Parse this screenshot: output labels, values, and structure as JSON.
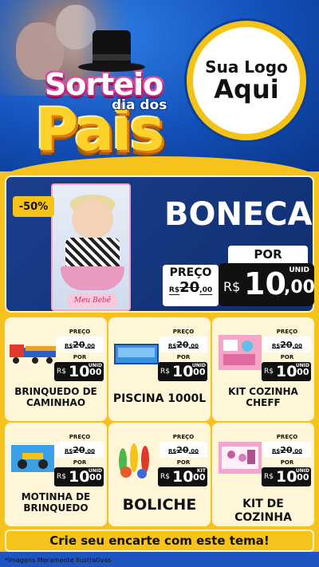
{
  "header": {
    "title_top": "Sorteio",
    "title_mid": "dia dos",
    "title_big": "Pais",
    "logo_line1": "Sua Logo",
    "logo_line2": "Aqui"
  },
  "hero": {
    "discount": "-50%",
    "box_label": "Meu Bebê",
    "name": "BONECA",
    "por_label": "POR",
    "preco_label": "PREÇO",
    "old_currency": "R$",
    "old_int": "20",
    "old_dec": ",00",
    "unit": "UNID",
    "new_currency": "R$",
    "new_int": "10",
    "new_dec": ",00"
  },
  "products": [
    {
      "name": "BRINQUEDO DE CAMINHAO",
      "preco_label": "PREÇO",
      "old_currency": "R$",
      "old_int": "20",
      "old_dec": ",00",
      "por_label": "POR",
      "new_currency": "R$",
      "new_int": "10",
      "new_dec": ",00",
      "unit": "UNID"
    },
    {
      "name": "PISCINA 1000L",
      "preco_label": "PREÇO",
      "old_currency": "R$",
      "old_int": "20",
      "old_dec": ",00",
      "por_label": "POR",
      "new_currency": "R$",
      "new_int": "10",
      "new_dec": ",00",
      "unit": "UNID"
    },
    {
      "name": "KIT COZINHA CHEFF",
      "preco_label": "PREÇO",
      "old_currency": "R$",
      "old_int": "20",
      "old_dec": ",00",
      "por_label": "POR",
      "new_currency": "R$",
      "new_int": "10",
      "new_dec": ",00",
      "unit": "UNID"
    },
    {
      "name": "MOTINHA DE BRINQUEDO",
      "preco_label": "PREÇO",
      "old_currency": "R$",
      "old_int": "20",
      "old_dec": ",00",
      "por_label": "POR",
      "new_currency": "R$",
      "new_int": "10",
      "new_dec": ",00",
      "unit": "UNID"
    },
    {
      "name": "BOLICHE",
      "preco_label": "PREÇO",
      "old_currency": "R$",
      "old_int": "20",
      "old_dec": ",00",
      "por_label": "POR",
      "new_currency": "R$",
      "new_int": "10",
      "new_dec": ",00",
      "unit": "KIT"
    },
    {
      "name": "KIT DE COZINHA",
      "preco_label": "PREÇO",
      "old_currency": "R$",
      "old_int": "20",
      "old_dec": ",00",
      "por_label": "POR",
      "new_currency": "R$",
      "new_int": "10",
      "new_dec": ",00",
      "unit": "UNID"
    }
  ],
  "footer": {
    "cta": "Crie seu encarte com este tema!",
    "disclaimer": "*Imagens Meramente Ilustrativas"
  },
  "colors": {
    "brand_yellow": "#f6c21c",
    "brand_blue": "#1250b8",
    "price_black": "#111111"
  },
  "icons": {
    "products": [
      "truck-toy-image",
      "pool-image",
      "kitchen-kit-image",
      "motorbike-toy-image",
      "bowling-pins-image",
      "kitchen-set-image"
    ]
  }
}
